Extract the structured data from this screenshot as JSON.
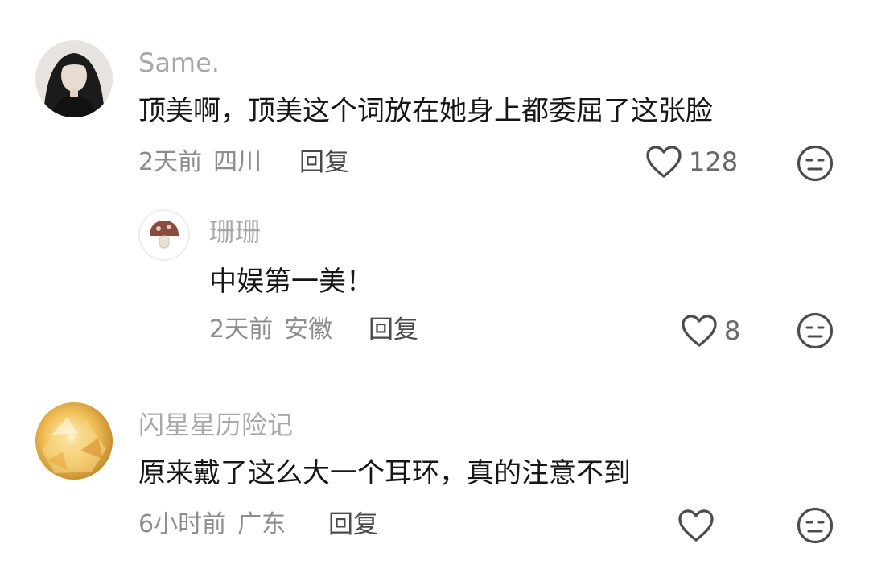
{
  "comments": [
    {
      "username": "Same.",
      "text": "顶美啊，顶美这个词放在她身上都委屈了这张脸",
      "time": "2天前",
      "location": "四川",
      "reply_label": "回复",
      "likes": "128",
      "avatar_icon": "portrait-photo"
    },
    {
      "username": "珊珊",
      "text": "中娱第一美！",
      "time": "2天前",
      "location": "安徽",
      "reply_label": "回复",
      "likes": "8",
      "avatar_icon": "mushroom-icon"
    },
    {
      "username": "闪星星历险记",
      "text": "原来戴了这么大一个耳环，真的注意不到",
      "time": "6小时前",
      "location": "广东",
      "reply_label": "回复",
      "likes": "",
      "avatar_icon": "amber-crystal-photo"
    }
  ],
  "icons": {
    "like": "heart-outline-icon",
    "dislike": "meh-face-icon"
  }
}
